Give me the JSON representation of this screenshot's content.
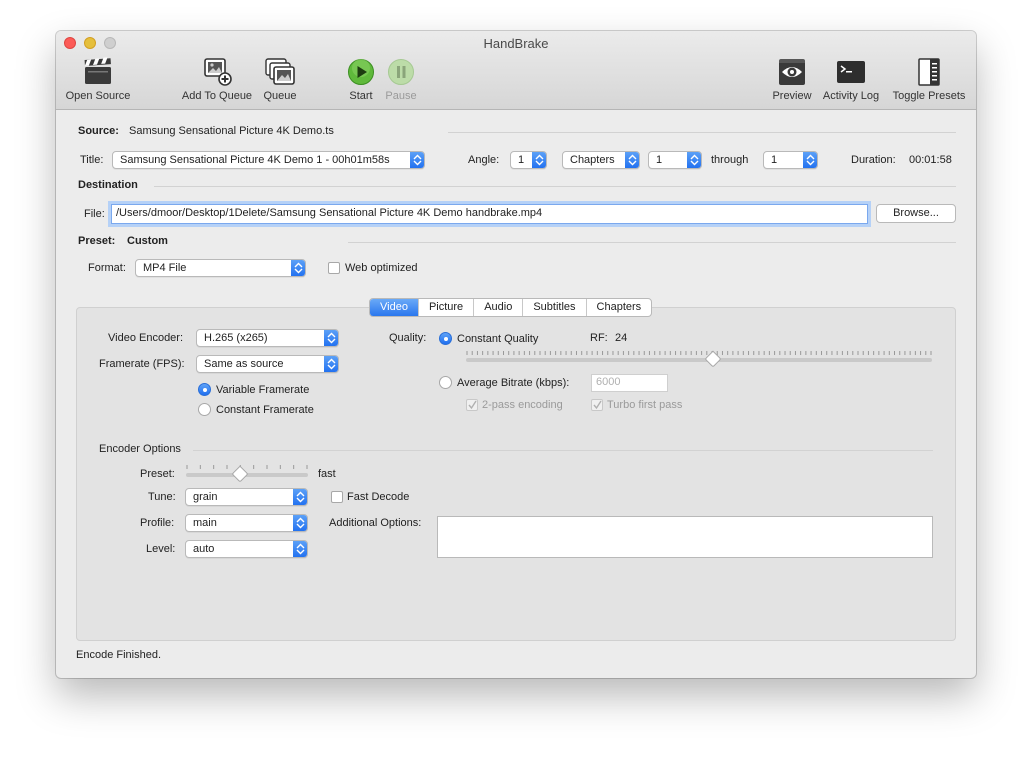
{
  "window": {
    "title": "HandBrake"
  },
  "toolbar": {
    "open_source": "Open Source",
    "add_to_queue": "Add To Queue",
    "queue": "Queue",
    "start": "Start",
    "pause": "Pause",
    "preview": "Preview",
    "activity_log": "Activity Log",
    "toggle_presets": "Toggle Presets"
  },
  "source": {
    "label": "Source:",
    "value": "Samsung Sensational Picture 4K Demo.ts"
  },
  "title_row": {
    "title_label": "Title:",
    "title_value": "Samsung Sensational Picture 4K Demo 1 - 00h01m58s",
    "angle_label": "Angle:",
    "angle_value": "1",
    "range_type": "Chapters",
    "range_start": "1",
    "through_label": "through",
    "range_end": "1",
    "duration_label": "Duration:",
    "duration_value": "00:01:58"
  },
  "destination": {
    "heading": "Destination",
    "file_label": "File:",
    "file_value": "/Users/dmoor/Desktop/1Delete/Samsung Sensational Picture 4K Demo handbrake.mp4",
    "browse_label": "Browse..."
  },
  "preset": {
    "label": "Preset:",
    "value": "Custom",
    "format_label": "Format:",
    "format_value": "MP4 File",
    "web_optimized_label": "Web optimized"
  },
  "tabs": [
    "Video",
    "Picture",
    "Audio",
    "Subtitles",
    "Chapters"
  ],
  "video": {
    "encoder_label": "Video Encoder:",
    "encoder_value": "H.265 (x265)",
    "framerate_label": "Framerate (FPS):",
    "framerate_value": "Same as source",
    "variable_framerate": "Variable Framerate",
    "constant_framerate": "Constant Framerate",
    "quality_label": "Quality:",
    "constant_quality": "Constant Quality",
    "rf_label": "RF:",
    "rf_value": "24",
    "average_bitrate": "Average Bitrate (kbps):",
    "bitrate_value": "6000",
    "two_pass": "2-pass encoding",
    "turbo_first_pass": "Turbo first pass",
    "quality_slider_fraction": 0.53
  },
  "encoder_options": {
    "heading": "Encoder Options",
    "preset_label": "Preset:",
    "preset_value": "fast",
    "preset_slider_fraction": 0.44,
    "tune_label": "Tune:",
    "tune_value": "grain",
    "fast_decode_label": "Fast Decode",
    "profile_label": "Profile:",
    "profile_value": "main",
    "additional_options_label": "Additional Options:",
    "level_label": "Level:",
    "level_value": "auto"
  },
  "status": {
    "text": "Encode Finished."
  },
  "colors": {
    "accent": "#2a77ee",
    "close": "#fc5b57",
    "minimize": "#e5bf3c"
  }
}
